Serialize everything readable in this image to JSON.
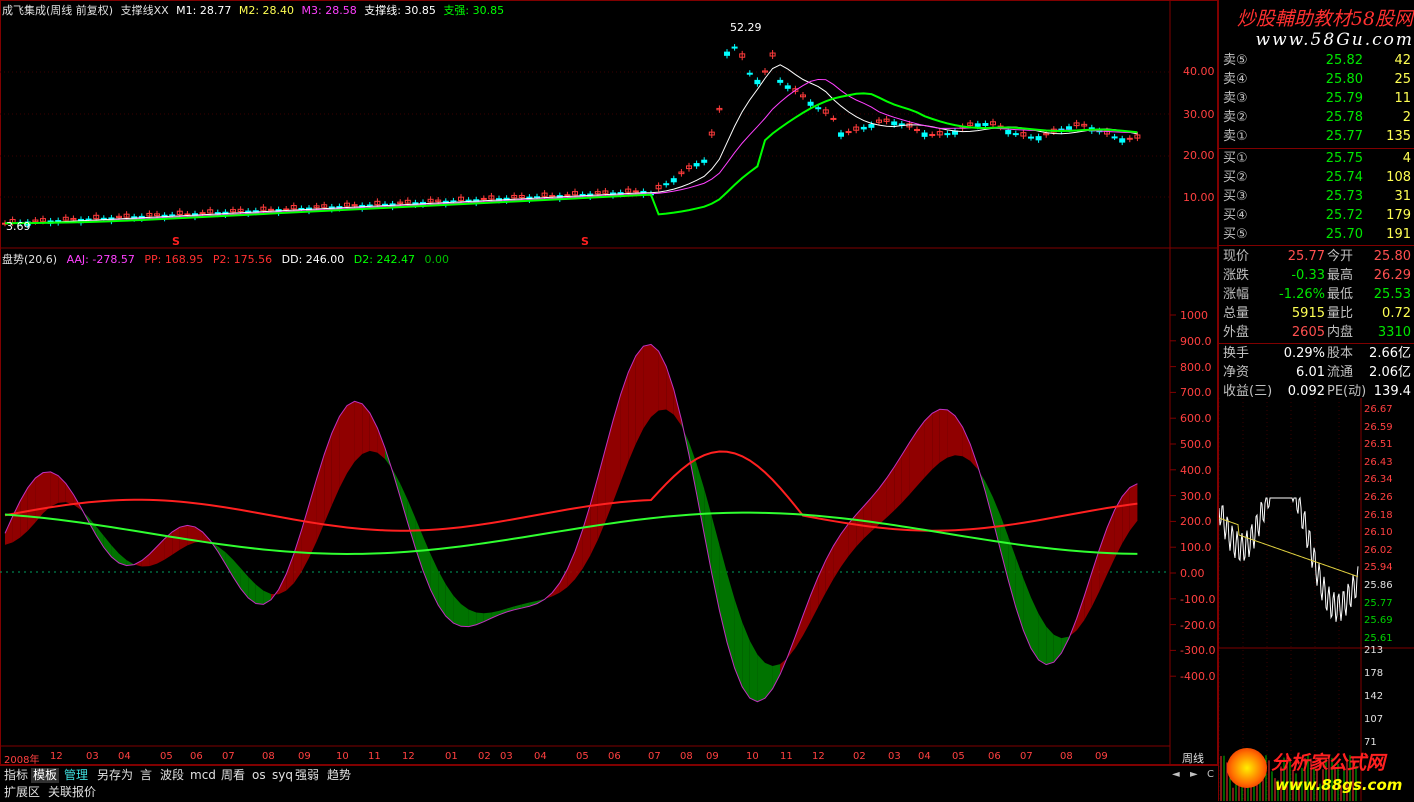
{
  "top_legend": {
    "name": "成飞集成(周线 前复权)",
    "ind": "支撑线XX",
    "m1": "M1: 28.77",
    "m2": "M2: 28.40",
    "m3": "M3: 28.58",
    "zc": "支撑线: 30.85",
    "zq": "支强: 30.85"
  },
  "top_chart": {
    "y_labels": [
      "40.00",
      "30.00",
      "20.00",
      "10.00"
    ],
    "high_label": "52.29",
    "low_label": "3.69",
    "marks": [
      "S",
      "S"
    ]
  },
  "bottom_legend": {
    "name": "盘势(20,6)",
    "aaj": "AAJ: -278.57",
    "pp": "PP: 168.95",
    "p2": "P2: 175.56",
    "dd": "DD: 246.00",
    "d2": "D2: 242.47",
    "z": "0.00"
  },
  "bottom_chart": {
    "y_labels": [
      "1000",
      "900.0",
      "800.0",
      "700.0",
      "600.0",
      "500.0",
      "400.0",
      "300.0",
      "200.0",
      "100.0",
      "0.00",
      "-100.0",
      "-200.0",
      "-300.0",
      "-400.0"
    ]
  },
  "x_axis": {
    "labels": [
      "2008年",
      "12",
      "03",
      "04",
      "05",
      "06",
      "07",
      "08",
      "09",
      "10",
      "11",
      "12",
      "01",
      "02",
      "03",
      "04",
      "05",
      "06",
      "07",
      "08",
      "09",
      "10",
      "11",
      "12",
      "02",
      "03",
      "04",
      "05",
      "06",
      "07",
      "08",
      "09"
    ],
    "period": "周线"
  },
  "toolbar": {
    "items": [
      "指标",
      "模板",
      "管理",
      "另存为",
      "言",
      "波段",
      "mcd",
      "周看",
      "os",
      "syq",
      "强弱",
      "趋势"
    ],
    "row2": [
      "扩展区",
      "关联报价"
    ]
  },
  "quote": {
    "sells": [
      {
        "label": "卖⑤",
        "price": "25.82",
        "vol": "42"
      },
      {
        "label": "卖④",
        "price": "25.80",
        "vol": "25"
      },
      {
        "label": "卖③",
        "price": "25.79",
        "vol": "11"
      },
      {
        "label": "卖②",
        "price": "25.78",
        "vol": "2"
      },
      {
        "label": "卖①",
        "price": "25.77",
        "vol": "135"
      }
    ],
    "buys": [
      {
        "label": "买①",
        "price": "25.75",
        "vol": "4"
      },
      {
        "label": "买②",
        "price": "25.74",
        "vol": "108"
      },
      {
        "label": "买③",
        "price": "25.73",
        "vol": "31"
      },
      {
        "label": "买④",
        "price": "25.72",
        "vol": "179"
      },
      {
        "label": "买⑤",
        "price": "25.70",
        "vol": "191"
      }
    ],
    "stats1": [
      {
        "l1": "现价",
        "v1": "25.77",
        "c1": "red",
        "l2": "今开",
        "v2": "25.80",
        "c2": "red"
      },
      {
        "l1": "涨跌",
        "v1": "-0.33",
        "c1": "green",
        "l2": "最高",
        "v2": "26.29",
        "c2": "red"
      },
      {
        "l1": "涨幅",
        "v1": "-1.26%",
        "c1": "green",
        "l2": "最低",
        "v2": "25.53",
        "c2": "green"
      },
      {
        "l1": "总量",
        "v1": "5915",
        "c1": "yellow",
        "l2": "量比",
        "v2": "0.72",
        "c2": "yellow"
      },
      {
        "l1": "外盘",
        "v1": "2605",
        "c1": "red",
        "l2": "内盘",
        "v2": "3310",
        "c2": "green"
      }
    ],
    "stats2": [
      {
        "l1": "换手",
        "v1": "0.29%",
        "l2": "股本",
        "v2": "2.66亿"
      },
      {
        "l1": "净资",
        "v1": "6.01",
        "l2": "流通",
        "v2": "2.06亿"
      },
      {
        "l1": "收益(三)",
        "v1": "0.092",
        "l2": "PE(动)",
        "v2": "139.4"
      }
    ]
  },
  "intraday": {
    "price_labels": [
      "26.67",
      "26.59",
      "26.51",
      "26.43",
      "26.34",
      "26.26",
      "26.18",
      "26.10",
      "26.02",
      "25.94",
      "25.86",
      "25.77",
      "25.69",
      "25.61"
    ],
    "vol_labels": [
      "213",
      "178",
      "142",
      "107",
      "71"
    ]
  },
  "logos": {
    "top": "炒股輔助教材58股网",
    "top_url": "www.58Gu.com",
    "bottom": "分析家公式网",
    "bottom_url": "www.88gs.com"
  },
  "colors": {
    "up": "#ff3c3c",
    "down": "#00ffff",
    "grid_red": "#800000"
  }
}
